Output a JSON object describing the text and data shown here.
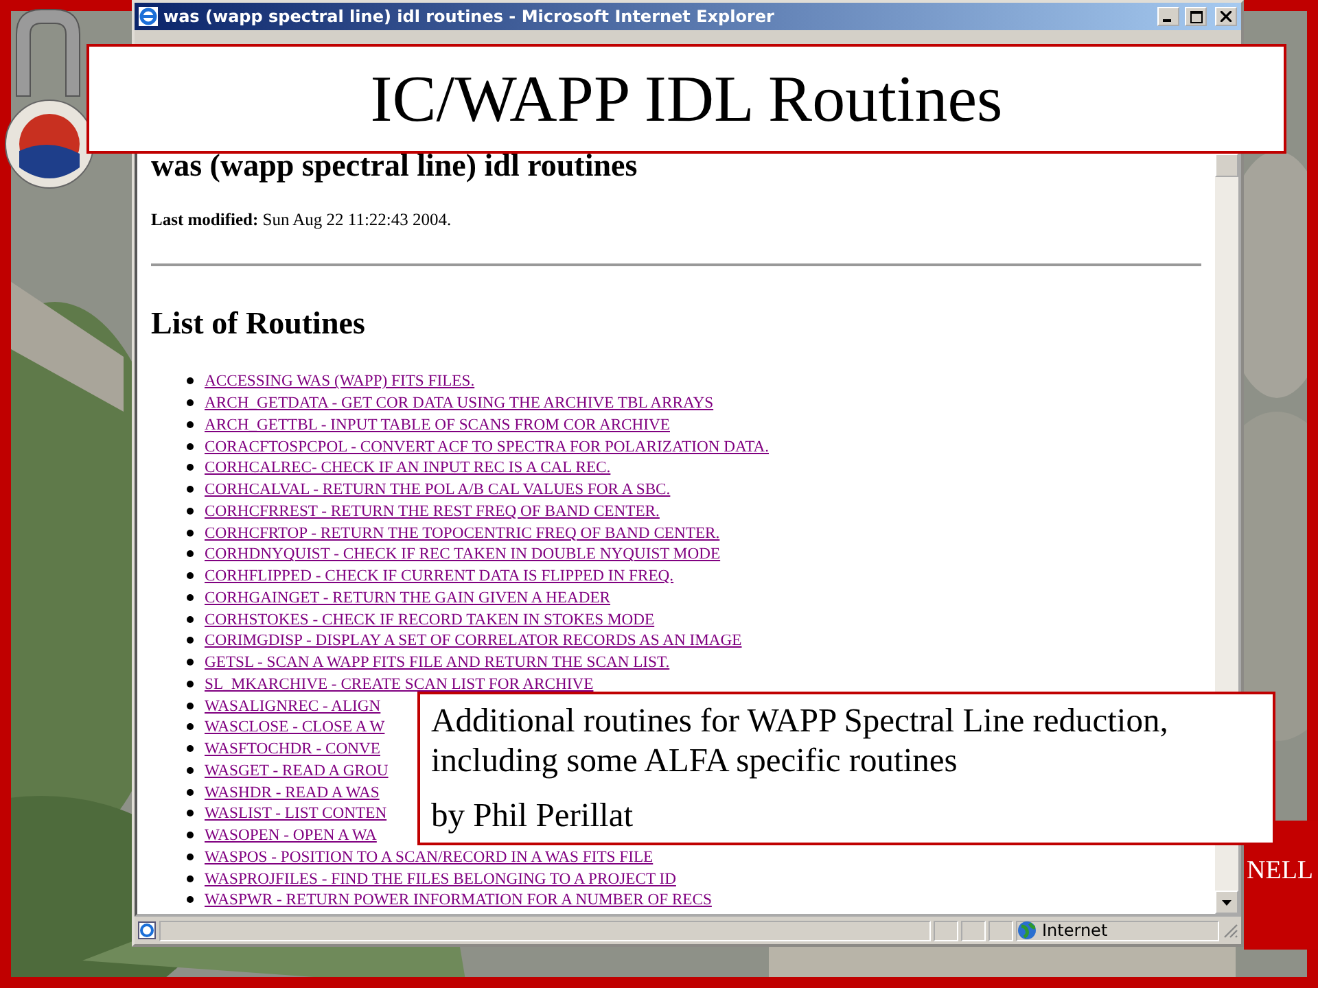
{
  "window": {
    "title": "was (wapp spectral line) idl routines - Microsoft Internet Explorer"
  },
  "page": {
    "heading": "was (wapp spectral line) idl routines",
    "modified_label": "Last modified:",
    "modified_value": "Sun Aug 22 11:22:43 2004.",
    "list_heading": "List of Routines",
    "routines": [
      "ACCESSING WAS (WAPP) FITS FILES.",
      "ARCH_GETDATA - GET COR DATA USING THE ARCHIVE TBL ARRAYS",
      "ARCH_GETTBL - INPUT TABLE OF SCANS FROM COR ARCHIVE",
      "CORACFTOSPCPOL - CONVERT ACF TO SPECTRA FOR POLARIZATION DATA.",
      "CORHCALREC- CHECK IF AN INPUT REC IS A CAL REC.",
      "CORHCALVAL - RETURN THE POL A/B CAL VALUES FOR A SBC.",
      "CORHCFRREST - RETURN THE REST FREQ OF BAND CENTER.",
      "CORHCFRTOP - RETURN THE TOPOCENTRIC FREQ OF BAND CENTER.",
      "CORHDNYQUIST - CHECK IF REC TAKEN IN DOUBLE NYQUIST MODE",
      "CORHFLIPPED - CHECK IF CURRENT DATA IS FLIPPED IN FREQ.",
      "CORHGAINGET - RETURN THE GAIN GIVEN A HEADER",
      "CORHSTOKES - CHECK IF RECORD TAKEN IN STOKES MODE",
      "CORIMGDISP - DISPLAY A SET OF CORRELATOR RECORDS AS AN IMAGE",
      "GETSL - SCAN A WAPP FITS FILE AND RETURN THE SCAN LIST.",
      "SL_MKARCHIVE - CREATE SCAN LIST FOR ARCHIVE",
      "WASALIGNREC - ALIGN",
      "WASCLOSE - CLOSE A W",
      "WASFTOCHDR - CONVE",
      "WASGET - READ A GROU",
      "WASHDR - READ A WAS",
      "WASLIST - LIST CONTEN",
      "WASOPEN - OPEN A WA",
      "WASPOS - POSITION TO A SCAN/RECORD IN A WAS FITS FILE",
      "WASPROJFILES - FIND THE FILES BELONGING TO A PROJECT ID",
      "WASPWR - RETURN POWER INFORMATION FOR A NUMBER OF RECS"
    ]
  },
  "status_bar": {
    "zone": "Internet"
  },
  "slide": {
    "title": "IC/WAPP IDL Routines",
    "callout": [
      "Additional routines for WAPP Spectral Line reduction, including some ALFA specific routines",
      "by Phil Perillat"
    ],
    "corner_text": "NELL"
  }
}
